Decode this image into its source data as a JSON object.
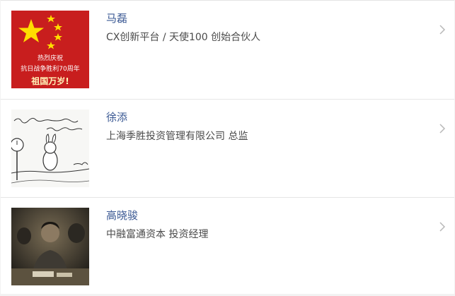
{
  "contacts": [
    {
      "name": "马磊",
      "title": "CX创新平台 / 天使100 创始合伙人",
      "avatar": {
        "icon": "china-flag-avatar",
        "line1": "热烈庆祝",
        "line2": "抗日战争胜利70周年",
        "line3": "祖国万岁!"
      }
    },
    {
      "name": "徐添",
      "title": "上海季胜投资管理有限公司 总监",
      "avatar": {
        "icon": "cartoon-sketch-avatar"
      }
    },
    {
      "name": "高晓骏",
      "title": "中融富通资本 投资经理",
      "avatar": {
        "icon": "photo-avatar"
      }
    }
  ],
  "colors": {
    "name": "#3a5893",
    "title": "#4a4a4a",
    "chevron": "#b8b8b8",
    "divider": "#e6e6e6",
    "page_bg": "#f2f2f2"
  }
}
